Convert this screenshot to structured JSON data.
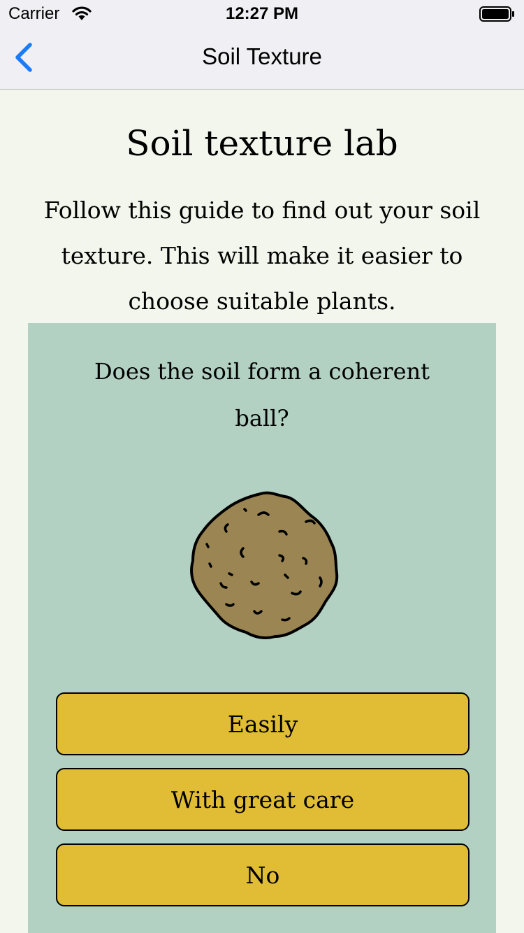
{
  "status_bar": {
    "carrier": "Carrier",
    "time": "12:27 PM"
  },
  "nav": {
    "title": "Soil Texture",
    "back_icon": "chevron-left-icon",
    "accent_color": "#1a7df5"
  },
  "content": {
    "title": "Soil texture lab",
    "intro": "Follow this guide to find out your soil texture. This will make it easier to choose suitable plants."
  },
  "card": {
    "question": "Does the soil form a coherent ball?",
    "image": "soil-ball-icon",
    "background_color": "#b2d1c3",
    "answers": [
      {
        "label": "Easily"
      },
      {
        "label": "With great care"
      },
      {
        "label": "No"
      }
    ],
    "button_color": "#e0bd34"
  }
}
